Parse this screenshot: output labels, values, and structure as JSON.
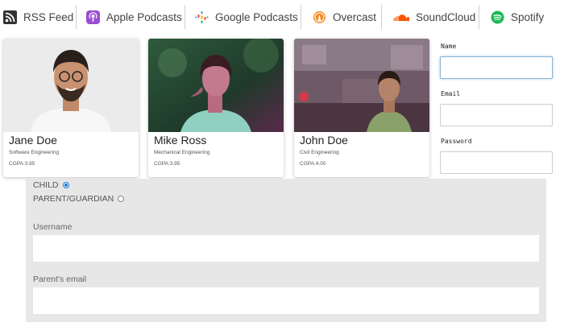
{
  "nav": {
    "items": [
      {
        "label": "RSS Feed",
        "icon": "rss-icon"
      },
      {
        "label": "Apple Podcasts",
        "icon": "apple-podcasts-icon"
      },
      {
        "label": "Google Podcasts",
        "icon": "google-podcasts-icon"
      },
      {
        "label": "Overcast",
        "icon": "overcast-icon"
      },
      {
        "label": "SoundCloud",
        "icon": "soundcloud-icon"
      },
      {
        "label": "Spotify",
        "icon": "spotify-icon"
      }
    ]
  },
  "cards": [
    {
      "name": "Jane Doe",
      "dept": "Software Engineering",
      "gpa": "CGPA:3.85"
    },
    {
      "name": "Mike Ross",
      "dept": "Mechanical Engineering",
      "gpa": "CGPA:3.95"
    },
    {
      "name": "John Doe",
      "dept": "Civil Engineering",
      "gpa": "CGPA:4.00"
    }
  ],
  "form": {
    "name_label": "Name",
    "email_label": "Email",
    "password_label": "Password"
  },
  "register": {
    "role_child": "CHILD",
    "role_parent": "PARENT/GUARDIAN",
    "username_label": "Username",
    "parent_email_label": "Parent's email"
  },
  "colors": {
    "accent": "#1976d2",
    "panel_bg": "#e7e7e7",
    "apple_podcasts": "#9b4dd1",
    "overcast": "#f28c28",
    "soundcloud": "#ff5500",
    "spotify": "#1db954"
  }
}
